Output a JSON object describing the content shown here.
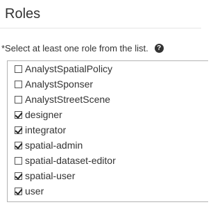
{
  "section": {
    "title": "Roles"
  },
  "instruction": {
    "text": "*Select at least one role from the list.",
    "help_icon": "question-circle-icon",
    "help_glyph": "?"
  },
  "roles": [
    {
      "label": "AnalystSpatialPolicy",
      "checked": false
    },
    {
      "label": "AnalystSponser",
      "checked": false
    },
    {
      "label": "AnalystStreetScene",
      "checked": false
    },
    {
      "label": "designer",
      "checked": true
    },
    {
      "label": "integrator",
      "checked": true
    },
    {
      "label": "spatial-admin",
      "checked": true
    },
    {
      "label": "spatial-dataset-editor",
      "checked": false
    },
    {
      "label": "spatial-user",
      "checked": true
    },
    {
      "label": "user",
      "checked": true
    }
  ]
}
